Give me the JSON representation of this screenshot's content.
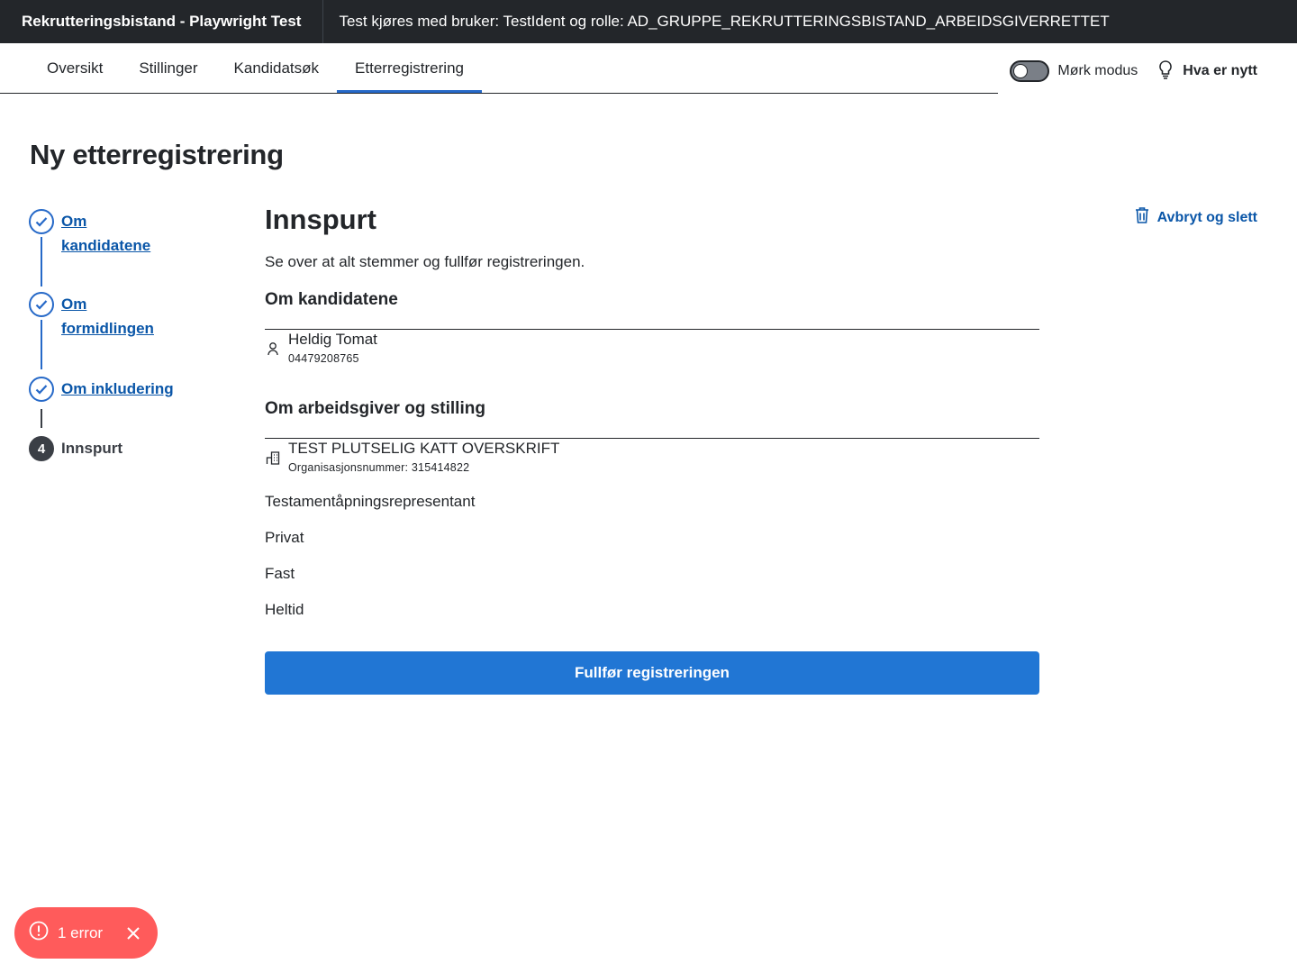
{
  "topbar": {
    "app_title": "Rekrutteringsbistand - Playwright Test",
    "test_info": "Test kjøres med bruker: TestIdent og rolle: AD_GRUPPE_REKRUTTERINGSBISTAND_ARBEIDSGIVERRETTET"
  },
  "nav": {
    "tabs": [
      {
        "label": "Oversikt",
        "active": false
      },
      {
        "label": "Stillinger",
        "active": false
      },
      {
        "label": "Kandidatsøk",
        "active": false
      },
      {
        "label": "Etterregistrering",
        "active": true
      }
    ],
    "dark_mode_label": "Mørk modus",
    "whats_new_label": "Hva er nytt"
  },
  "page": {
    "title": "Ny etterregistrering"
  },
  "stepper": {
    "steps": [
      {
        "label": "Om kandidatene",
        "status": "done"
      },
      {
        "label": "Om formidlingen",
        "status": "done"
      },
      {
        "label": "Om inkludering",
        "status": "done"
      },
      {
        "label": "Innspurt",
        "status": "current",
        "number": "4"
      }
    ]
  },
  "main": {
    "title": "Innspurt",
    "cancel_label": "Avbryt og slett",
    "intro": "Se over at alt stemmer og fullfør registreringen.",
    "candidates_heading": "Om kandidatene",
    "candidate": {
      "name": "Heldig Tomat",
      "id": "04479208765"
    },
    "employer_heading": "Om arbeidsgiver og stilling",
    "employer": {
      "name": "TEST PLUTSELIG KATT OVERSKRIFT",
      "org": "Organisasjonsnummer: 315414822"
    },
    "details": [
      "Testamentåpningsrepresentant",
      "Privat",
      "Fast",
      "Heltid"
    ],
    "submit_label": "Fullfør registreringen"
  },
  "toast": {
    "text": "1 error"
  },
  "colors": {
    "topbar_bg": "#23262a",
    "accent": "#2669c8",
    "link": "#0a56a8",
    "button": "#2176d4",
    "error_toast": "#ff5b5b"
  }
}
